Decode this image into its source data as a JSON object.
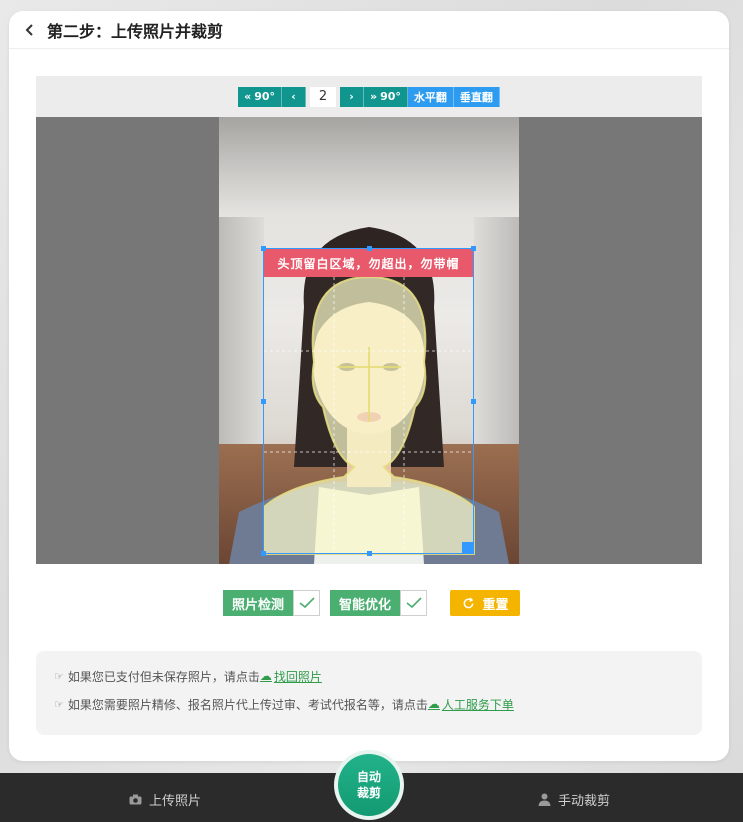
{
  "header": {
    "title": "第二步：上传照片并裁剪"
  },
  "toolbar": {
    "rotate_left_label": "90°",
    "page_value": "2",
    "rotate_right_label": "90°",
    "flip_h_label": "水平翻",
    "flip_v_label": "垂直翻"
  },
  "crop": {
    "banner_text": "头顶留白区域，勿超出，勿带帽"
  },
  "actions": {
    "check_photo_label": "照片检测",
    "optimize_label": "智能优化",
    "reset_label": "重置"
  },
  "notice": {
    "line1_text": "如果您已支付但未保存照片，请点击",
    "line1_link": "找回照片",
    "line2_text": "如果您需要照片精修、报名照片代上传过审、考试代报名等，请点击",
    "line2_link": "人工服务下单"
  },
  "bottom_bar": {
    "upload_label": "上传照片",
    "auto_crop_line1": "自动",
    "auto_crop_line2": "裁剪",
    "manual_crop_label": "手动裁剪"
  },
  "colors": {
    "teal": "#10968f",
    "blue": "#2d9cf0",
    "green": "#4caf72",
    "orange": "#f4b400",
    "crop_border": "#3399ff",
    "banner": "#e85a6b",
    "link": "#2e9c4a"
  },
  "icons": [
    "back-arrow-icon",
    "double-chevron-left-icon",
    "chevron-left-icon",
    "chevron-right-icon",
    "double-chevron-right-icon",
    "checkmark-icon",
    "refresh-icon",
    "pointing-hand-icon",
    "upload-cloud-icon",
    "camera-icon",
    "person-icon"
  ]
}
